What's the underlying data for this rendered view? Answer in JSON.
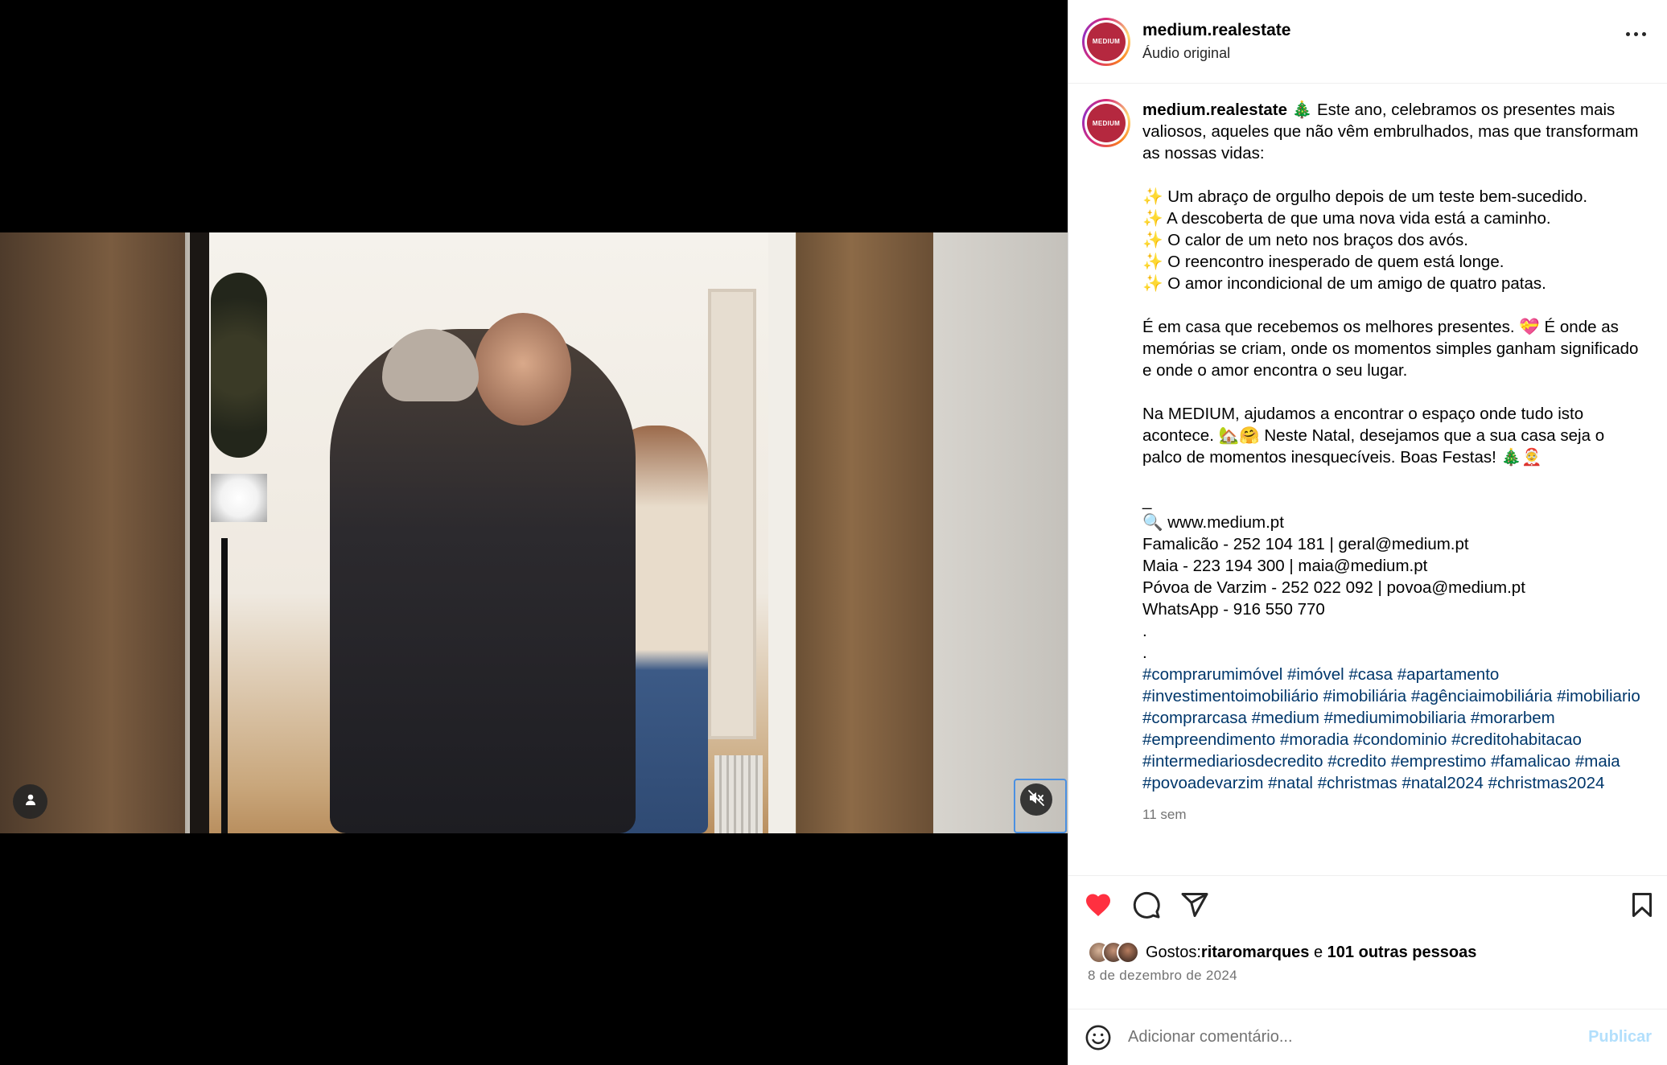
{
  "post": {
    "username": "medium.realestate",
    "audio": "Áudio original",
    "avatar_text": "MEDIUM"
  },
  "caption": {
    "username": "medium.realestate",
    "lines": [
      " 🎄 Este ano, celebramos os presentes mais valiosos, aqueles que não vêm embrulhados, mas que transformam as nossas vidas:",
      "",
      "✨ Um abraço de orgulho depois de um teste bem-sucedido.",
      "✨ A descoberta de que uma nova vida está a caminho.",
      "✨ O calor de um neto nos braços dos avós.",
      "✨ O reencontro inesperado de quem está longe.",
      "✨ O amor incondicional de um amigo de quatro patas.",
      "",
      "É em casa que recebemos os melhores presentes. 💝 É onde as memórias se criam, onde os momentos simples ganham significado e onde o amor encontra o seu lugar.",
      "",
      "Na MEDIUM, ajudamos a encontrar o espaço onde tudo isto acontece. 🏡🤗 Neste Natal, desejamos que a sua casa seja o palco de momentos inesquecíveis. Boas Festas! 🎄🤶",
      "",
      "_",
      "🔍 www.medium.pt",
      "Famalicão - 252 104 181 | geral@medium.pt",
      "Maia - 223 194 300 | maia@medium.pt",
      "Póvoa de Varzim - 252 022 092 | povoa@medium.pt",
      "WhatsApp - 916 550 770",
      ".",
      "."
    ],
    "hashtags": "#comprarumimóvel #imóvel #casa #apartamento #investimentoimobiliário #imobiliária #agênciaimobiliária #imobiliario #comprarcasa #medium #mediumimobiliaria #morarbem #empreendimento #moradia #condominio #creditohabitacao #intermediariosdecredito #credito #emprestimo #famalicao #maia #povoadevarzim #natal #christmas #natal2024 #christmas2024",
    "time_ago": "11 sem"
  },
  "likes": {
    "prefix": "Gostos: ",
    "user": "ritaromarques",
    "joiner": " e ",
    "others": "101 outras pessoas"
  },
  "date": "8 de dezembro de 2024",
  "comment": {
    "placeholder": "Adicionar comentário...",
    "publish": "Publicar"
  },
  "colors": {
    "like_red": "#ff3040",
    "hashtag_blue": "#00376b",
    "publish_disabled": "#b2dffc",
    "brand": "#b5283f"
  },
  "icons": {
    "like": "heart-filled-icon",
    "comment": "comment-bubble-icon",
    "share": "paper-plane-icon",
    "save": "bookmark-icon",
    "emoji": "smiley-icon",
    "mute": "speaker-muted-icon",
    "user_tag": "user-silhouette-icon",
    "more": "more-dots-icon"
  }
}
